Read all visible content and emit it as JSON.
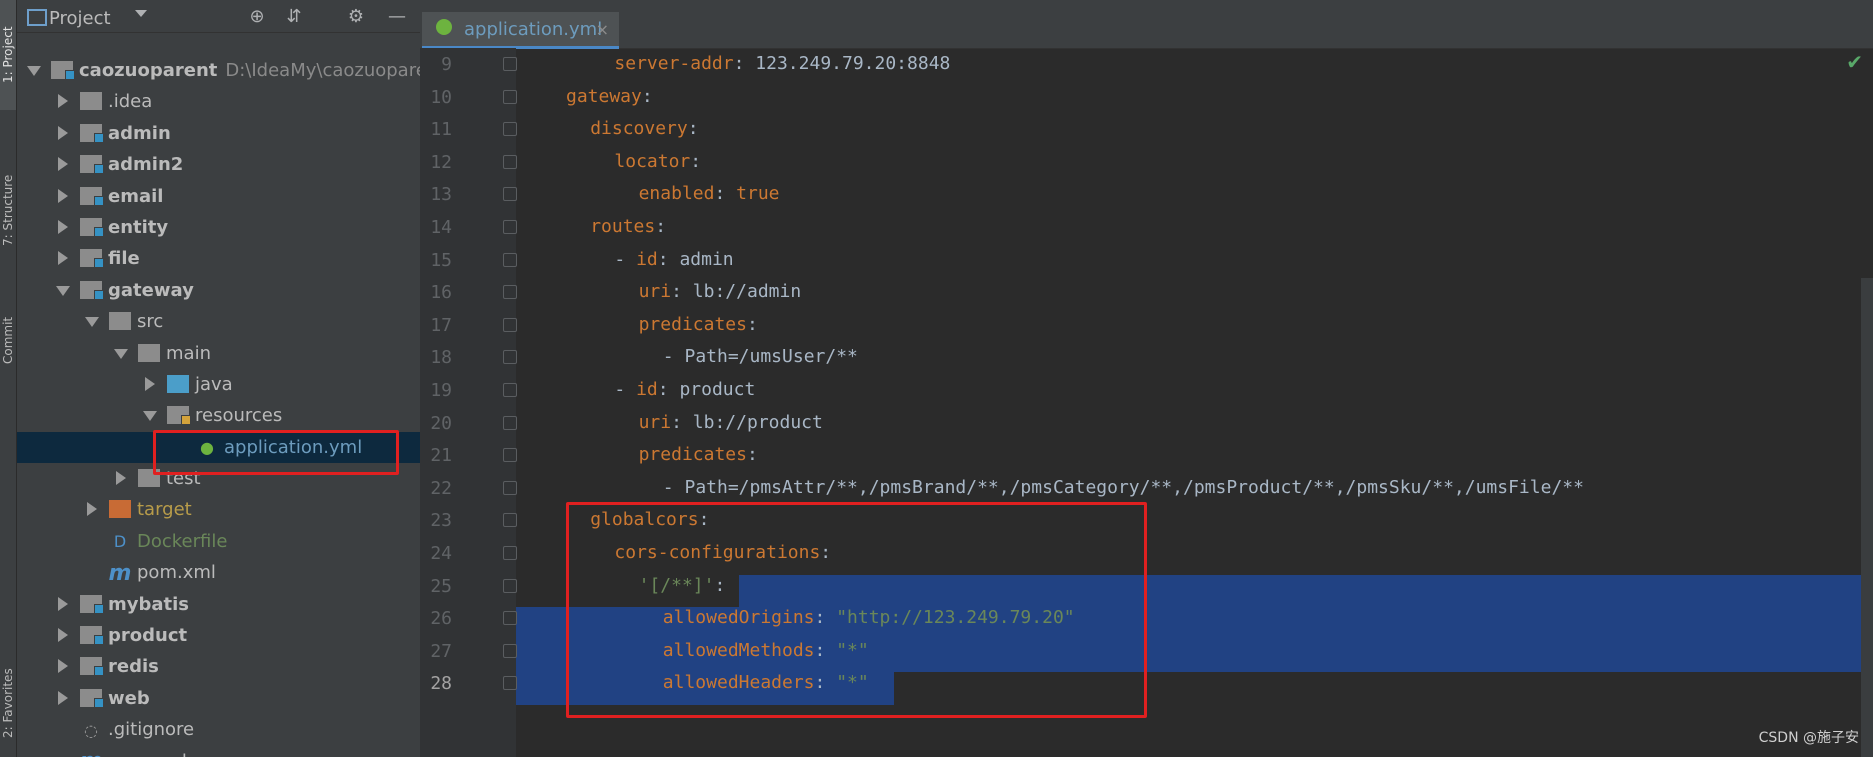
{
  "side_stripe": {
    "project_label": "1: Project",
    "structure_label": "7: Structure",
    "commit_label": "Commit",
    "favorites_label": "2: Favorites"
  },
  "project_panel": {
    "title": "Project",
    "tree": [
      {
        "label": "caozuoparent",
        "path": "D:\\IdeaMy\\caozuoparent",
        "depth": 0,
        "expanded": true,
        "kind": "module",
        "bold": true
      },
      {
        "label": ".idea",
        "depth": 1,
        "expanded": false,
        "kind": "folder",
        "bold": false
      },
      {
        "label": "admin",
        "depth": 1,
        "expanded": false,
        "kind": "module",
        "bold": true
      },
      {
        "label": "admin2",
        "depth": 1,
        "expanded": false,
        "kind": "module",
        "bold": true
      },
      {
        "label": "email",
        "depth": 1,
        "expanded": false,
        "kind": "module",
        "bold": true
      },
      {
        "label": "entity",
        "depth": 1,
        "expanded": false,
        "kind": "module",
        "bold": true
      },
      {
        "label": "file",
        "depth": 1,
        "expanded": false,
        "kind": "module",
        "bold": true
      },
      {
        "label": "gateway",
        "depth": 1,
        "expanded": true,
        "kind": "module",
        "bold": true
      },
      {
        "label": "src",
        "depth": 2,
        "expanded": true,
        "kind": "folder",
        "bold": false
      },
      {
        "label": "main",
        "depth": 3,
        "expanded": true,
        "kind": "folder",
        "bold": false
      },
      {
        "label": "java",
        "depth": 4,
        "expanded": false,
        "kind": "source-folder",
        "bold": false
      },
      {
        "label": "resources",
        "depth": 4,
        "expanded": true,
        "kind": "resource-folder",
        "bold": false
      },
      {
        "label": "application.yml",
        "depth": 5,
        "kind": "yml-file",
        "bold": false,
        "selected": true
      },
      {
        "label": "test",
        "depth": 3,
        "expanded": false,
        "kind": "folder",
        "bold": false
      },
      {
        "label": "target",
        "depth": 2,
        "expanded": false,
        "kind": "excluded-folder",
        "bold": false
      },
      {
        "label": "Dockerfile",
        "depth": 2,
        "kind": "docker-file",
        "bold": false
      },
      {
        "label": "pom.xml",
        "depth": 2,
        "kind": "maven-file",
        "bold": false
      },
      {
        "label": "mybatis",
        "depth": 1,
        "expanded": false,
        "kind": "module",
        "bold": true
      },
      {
        "label": "product",
        "depth": 1,
        "expanded": false,
        "kind": "module",
        "bold": true
      },
      {
        "label": "redis",
        "depth": 1,
        "expanded": false,
        "kind": "module",
        "bold": true
      },
      {
        "label": "web",
        "depth": 1,
        "expanded": false,
        "kind": "module",
        "bold": true
      },
      {
        "label": ".gitignore",
        "depth": 1,
        "kind": "gitignore-file",
        "bold": false
      },
      {
        "label": "pom.xml",
        "depth": 1,
        "kind": "maven-file",
        "bold": false
      }
    ]
  },
  "editor": {
    "tab_label": "application.yml",
    "tab_close": "×",
    "lines": [
      {
        "n": "9",
        "indent": 3,
        "tokens": [
          [
            "k",
            "server-addr"
          ],
          [
            "p",
            ": "
          ],
          [
            "v",
            "123.249.79.20:8848"
          ]
        ]
      },
      {
        "n": "10",
        "indent": 1,
        "tokens": [
          [
            "k",
            "gateway"
          ],
          [
            "p",
            ":"
          ]
        ]
      },
      {
        "n": "11",
        "indent": 2,
        "tokens": [
          [
            "k",
            "discovery"
          ],
          [
            "p",
            ":"
          ]
        ]
      },
      {
        "n": "12",
        "indent": 3,
        "tokens": [
          [
            "k",
            "locator"
          ],
          [
            "p",
            ":"
          ]
        ]
      },
      {
        "n": "13",
        "indent": 4,
        "tokens": [
          [
            "k",
            "enabled"
          ],
          [
            "p",
            ": "
          ],
          [
            "k",
            "true"
          ]
        ]
      },
      {
        "n": "14",
        "indent": 2,
        "tokens": [
          [
            "k",
            "routes"
          ],
          [
            "p",
            ":"
          ]
        ]
      },
      {
        "n": "15",
        "indent": 3,
        "tokens": [
          [
            "p",
            "- "
          ],
          [
            "k",
            "id"
          ],
          [
            "p",
            ": "
          ],
          [
            "v",
            "admin"
          ]
        ]
      },
      {
        "n": "16",
        "indent": 4,
        "tokens": [
          [
            "k",
            "uri"
          ],
          [
            "p",
            ": "
          ],
          [
            "v",
            "lb://admin"
          ]
        ]
      },
      {
        "n": "17",
        "indent": 4,
        "tokens": [
          [
            "k",
            "predicates"
          ],
          [
            "p",
            ":"
          ]
        ]
      },
      {
        "n": "18",
        "indent": 5,
        "tokens": [
          [
            "p",
            "- "
          ],
          [
            "v",
            "Path=/umsUser/**"
          ]
        ]
      },
      {
        "n": "19",
        "indent": 3,
        "tokens": [
          [
            "p",
            "- "
          ],
          [
            "k",
            "id"
          ],
          [
            "p",
            ": "
          ],
          [
            "v",
            "product"
          ]
        ]
      },
      {
        "n": "20",
        "indent": 4,
        "tokens": [
          [
            "k",
            "uri"
          ],
          [
            "p",
            ": "
          ],
          [
            "v",
            "lb://product"
          ]
        ]
      },
      {
        "n": "21",
        "indent": 4,
        "tokens": [
          [
            "k",
            "predicates"
          ],
          [
            "p",
            ":"
          ]
        ]
      },
      {
        "n": "22",
        "indent": 5,
        "tokens": [
          [
            "p",
            "- "
          ],
          [
            "v",
            "Path=/pmsAttr/**,/pmsBrand/**,/pmsCategory/**,/pmsProduct/**,/pmsSku/**,/umsFile/**"
          ]
        ]
      },
      {
        "n": "23",
        "indent": 2,
        "tokens": [
          [
            "k",
            "globalcors"
          ],
          [
            "p",
            ":"
          ]
        ]
      },
      {
        "n": "24",
        "indent": 3,
        "tokens": [
          [
            "k",
            "cors-configurations"
          ],
          [
            "p",
            ":"
          ]
        ]
      },
      {
        "n": "25",
        "indent": 4,
        "tokens": [
          [
            "s",
            "'[/**]'"
          ],
          [
            "p",
            ":"
          ]
        ]
      },
      {
        "n": "26",
        "indent": 5,
        "tokens": [
          [
            "k",
            "allowedOrigins"
          ],
          [
            "p",
            ": "
          ],
          [
            "s",
            "\"http://123.249.79.20\""
          ]
        ]
      },
      {
        "n": "27",
        "indent": 5,
        "tokens": [
          [
            "k",
            "allowedMethods"
          ],
          [
            "p",
            ": "
          ],
          [
            "s",
            "\"*\""
          ]
        ]
      },
      {
        "n": "28",
        "indent": 5,
        "tokens": [
          [
            "k",
            "allowedHeaders"
          ],
          [
            "p",
            ": "
          ],
          [
            "s",
            "\"*\""
          ]
        ]
      }
    ],
    "current_line": "28"
  },
  "watermark": "CSDN @施子安",
  "colors": {
    "highlight_box": "#e02020",
    "selection": "#214283",
    "keyword": "#cc7832",
    "string": "#6a8759"
  }
}
